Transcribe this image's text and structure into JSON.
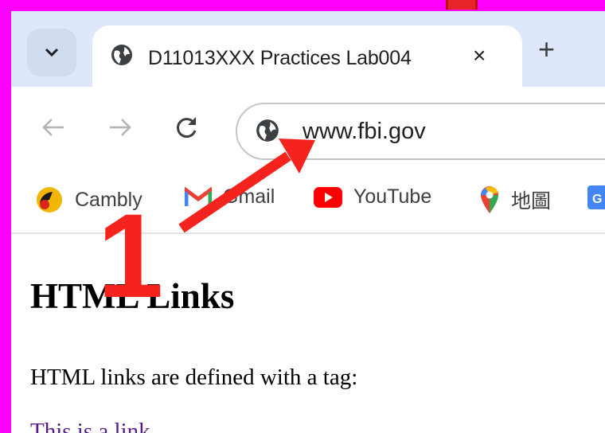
{
  "browser": {
    "tab": {
      "title": "D11013XXX Practices Lab004",
      "close_glyph": "×",
      "favicon": "globe-icon"
    },
    "tab_search_icon": "chevron-down-icon",
    "new_tab_glyph": "+",
    "toolbar": {
      "back_icon": "arrow-left-icon",
      "forward_icon": "arrow-right-icon",
      "reload_icon": "reload-icon",
      "site_info_icon": "globe-icon",
      "url": "www.fbi.gov"
    },
    "bookmarks": [
      {
        "label": "Cambly",
        "icon": "cambly-icon"
      },
      {
        "label": "Gmail",
        "icon": "gmail-icon"
      },
      {
        "label": "YouTube",
        "icon": "youtube-icon"
      },
      {
        "label": "地圖",
        "icon": "maps-icon"
      }
    ]
  },
  "page": {
    "heading": "HTML Links",
    "paragraph": "HTML links are defined with a tag:",
    "link_text": "This is a link"
  },
  "annotation": {
    "number": "1",
    "color": "#f5231d"
  },
  "colors": {
    "frame": "#ff00ff",
    "tabstrip": "#dfe8fb",
    "visited_link": "#551a8b"
  }
}
